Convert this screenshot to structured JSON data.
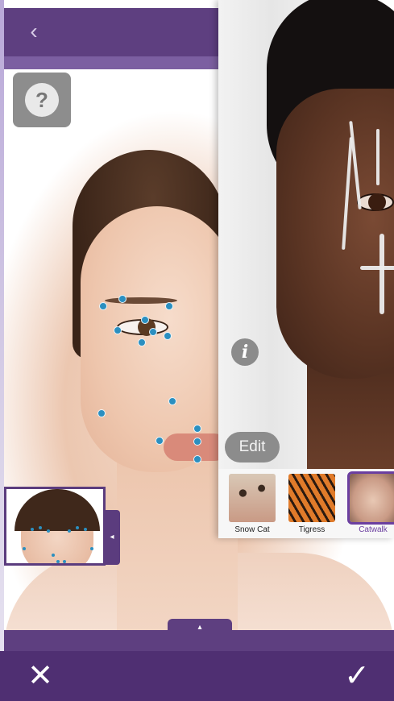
{
  "screen_left": {
    "back_icon": "chevron-left-icon",
    "help_icon": "question-mark-icon",
    "help_glyph": "?",
    "collapse_glyph": "◂",
    "expand_glyph": "▴",
    "close_glyph": "✕",
    "confirm_glyph": "✓"
  },
  "screen_right": {
    "info_glyph": "i",
    "edit_label": "Edit",
    "looks": [
      {
        "label": "Snow Cat",
        "selected": false
      },
      {
        "label": "Tigress",
        "selected": false
      },
      {
        "label": "Catwalk",
        "selected": true
      }
    ]
  },
  "colors": {
    "brand_purple": "#5e3f80",
    "bottom_bar": "#4f2f72",
    "landmark_dot": "#2b8fc0",
    "selected_look": "#6b3fa0"
  }
}
